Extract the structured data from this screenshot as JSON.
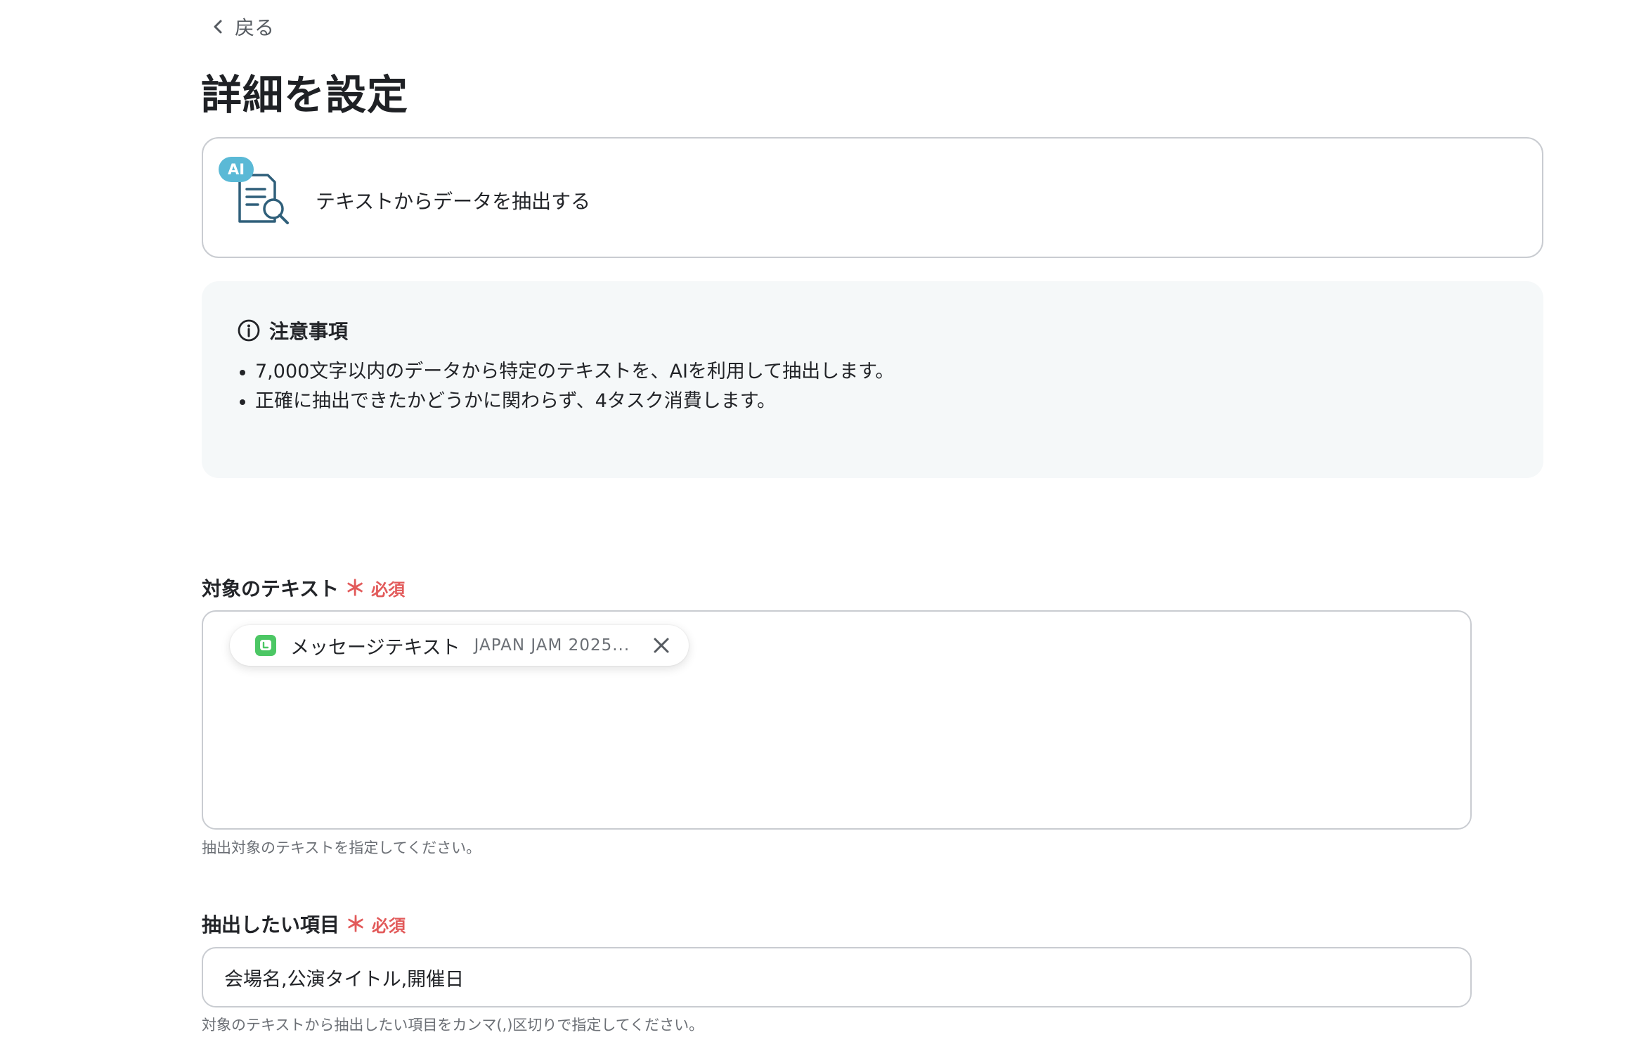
{
  "nav": {
    "back_label": "戻る"
  },
  "page": {
    "title": "詳細を設定"
  },
  "action": {
    "badge": "AI",
    "label": "テキストからデータを抽出する"
  },
  "notice": {
    "heading": "注意事項",
    "items": [
      "7,000文字以内のデータから特定のテキストを、AIを利用して抽出します。",
      "正確に抽出できたかどうかに関わらず、4タスク消費します。"
    ]
  },
  "target_text": {
    "label": "対象のテキスト",
    "required_star": "＊",
    "required_label": "必須",
    "chip": {
      "name": "メッセージテキスト",
      "value": "JAPAN JAM 2025..."
    },
    "help": "抽出対象のテキストを指定してください。"
  },
  "extract_items": {
    "label": "抽出したい項目",
    "required_star": "＊",
    "required_label": "必須",
    "value": "会場名,公演タイトル,開催日",
    "help": "対象のテキストから抽出したい項目をカンマ(,)区切りで指定してください。"
  },
  "colors": {
    "required": "#e25a5a",
    "ai_badge": "#5ab9d6",
    "doc_icon": "#2f5f7a",
    "line_green": "#4cc764",
    "border": "#c9ccd1",
    "notice_bg": "#f5f8f9"
  },
  "icons": {
    "back": "chevron-left-icon",
    "action": "ai-document-search-icon",
    "notice": "info-circle-icon",
    "chip": "line-app-icon",
    "chip_remove": "close-icon"
  }
}
